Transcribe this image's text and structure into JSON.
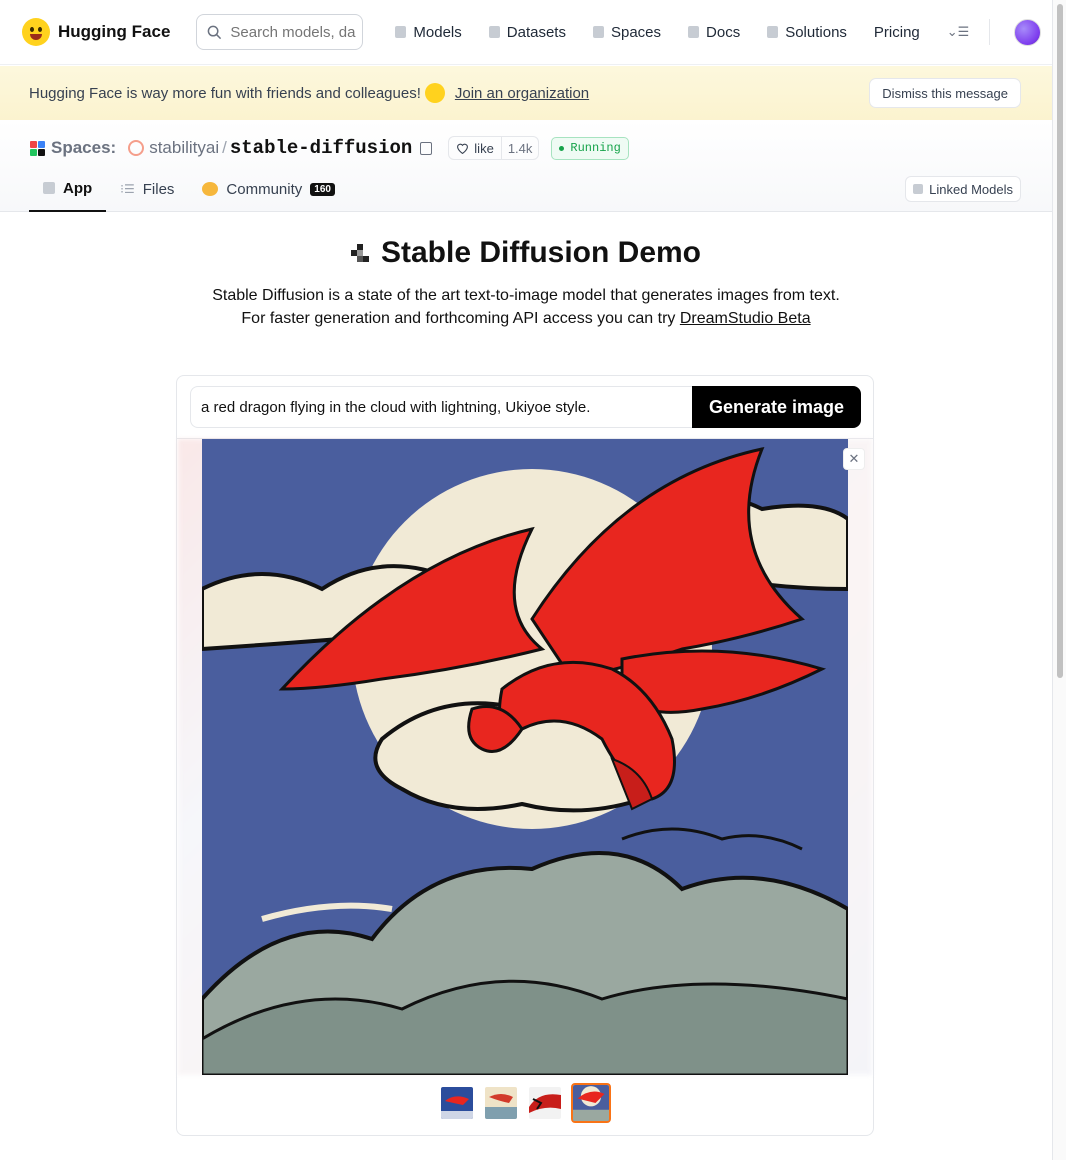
{
  "brand": {
    "name": "Hugging Face"
  },
  "search": {
    "placeholder": "Search models, da"
  },
  "nav": {
    "models": "Models",
    "datasets": "Datasets",
    "spaces": "Spaces",
    "docs": "Docs",
    "solutions": "Solutions",
    "pricing": "Pricing"
  },
  "banner": {
    "text": "Hugging Face is way more fun with friends and colleagues!",
    "link": "Join an organization",
    "dismiss": "Dismiss this message"
  },
  "space": {
    "section": "Spaces:",
    "org": "stabilityai",
    "repo": "stable-diffusion",
    "like_label": "like",
    "like_count": "1.4k",
    "status": "Running",
    "linked_models": "Linked Models"
  },
  "tabs": {
    "app": "App",
    "files": "Files",
    "community": "Community",
    "community_count": "160"
  },
  "demo": {
    "title": "Stable Diffusion Demo",
    "desc_line1": "Stable Diffusion is a state of the art text-to-image model that generates images from text.",
    "desc_line2_prefix": "For faster generation and forthcoming API access you can try ",
    "desc_link": "DreamStudio Beta",
    "prompt_value": "a red dragon flying in the cloud with lightning, Ukiyoe style.",
    "generate_button": "Generate image",
    "close_symbol": "✕",
    "thumbnails_count": 4,
    "selected_thumbnail": 4
  },
  "colors": {
    "accent_selected": "#f97316",
    "running_green": "#16a34a",
    "banner_bg": "#fbf3cf"
  }
}
